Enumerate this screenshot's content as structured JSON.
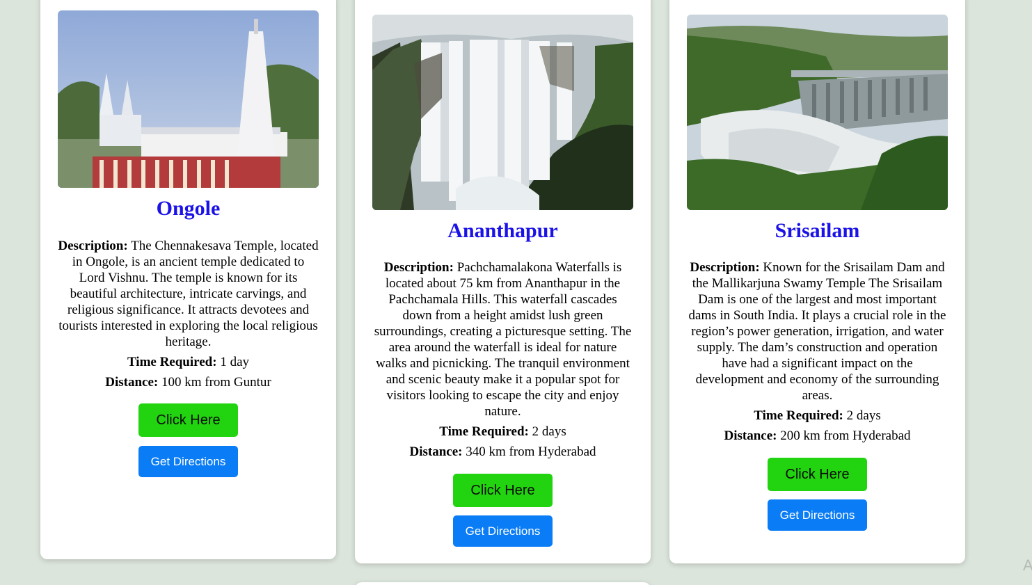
{
  "cards": [
    {
      "title": "Ongole",
      "image_alt": "Chennakesava Temple",
      "desc_label": "Description:",
      "desc": "The Chennakesava Temple, located in Ongole, is an ancient temple dedicated to Lord Vishnu. The temple is known for its beautiful architecture, intricate carvings, and religious significance. It attracts devotees and tourists interested in exploring the local religious heritage.",
      "time_label": "Time Required:",
      "time": "1 day",
      "distance_label": "Distance:",
      "distance": "100 km from Guntur",
      "click_label": "Click Here",
      "directions_label": "Get Directions"
    },
    {
      "title": "Ananthapur",
      "image_alt": "Pachchamalakona Waterfalls",
      "desc_label": "Description:",
      "desc": "Pachchamalakona Waterfalls is located about 75 km from Ananthapur in the Pachchamala Hills. This waterfall cascades down from a height amidst lush green surroundings, creating a picturesque setting. The area around the waterfall is ideal for nature walks and picnicking. The tranquil environment and scenic beauty make it a popular spot for visitors looking to escape the city and enjoy nature.",
      "time_label": "Time Required:",
      "time": "2 days",
      "distance_label": "Distance:",
      "distance": "340 km from Hyderabad",
      "click_label": "Click Here",
      "directions_label": "Get Directions"
    },
    {
      "title": "Srisailam",
      "image_alt": "Srisailam Dam",
      "desc_label": "Description:",
      "desc": "Known for the Srisailam Dam and the Mallikarjuna Swamy Temple The Srisailam Dam is one of the largest and most important dams in South India. It plays a crucial role in the region’s power generation, irrigation, and water supply. The dam’s construction and operation have had a significant impact on the development and economy of the surrounding areas.",
      "time_label": "Time Required:",
      "time": "2 days",
      "distance_label": "Distance:",
      "distance": "200 km from Hyderabad",
      "click_label": "Click Here",
      "directions_label": "Get Directions"
    }
  ],
  "corner_glyph": "A",
  "colors": {
    "background": "#dce5dc",
    "title": "#1a12e6",
    "click_button": "#22d40f",
    "directions_button": "#0a7cf5"
  }
}
